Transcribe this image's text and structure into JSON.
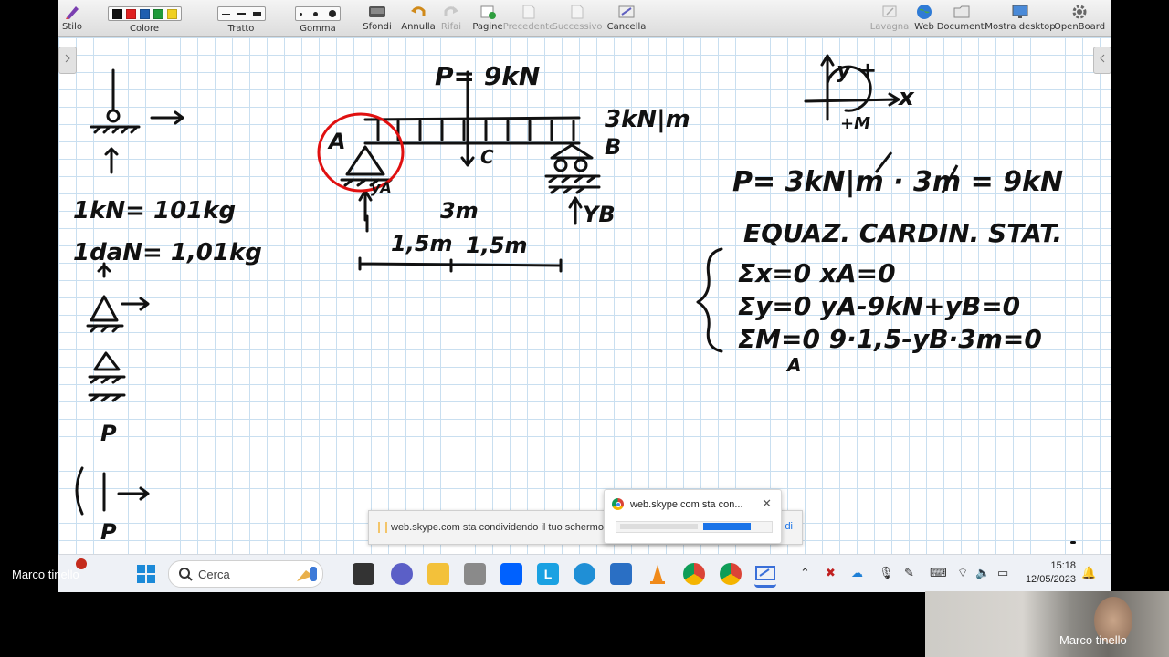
{
  "toolbar": {
    "stilo": "Stilo",
    "colore": "Colore",
    "tratto": "Tratto",
    "gomma": "Gomma",
    "sfondi": "Sfondi",
    "annulla": "Annulla",
    "rifai": "Rifai",
    "pagine": "Pagine",
    "precedente": "Precedente",
    "successivo": "Successivo",
    "cancella": "Cancella",
    "lavagna": "Lavagna",
    "web": "Web",
    "documenti": "Documenti",
    "mostra_desktop": "Mostra desktop",
    "openboard": "OpenBoard",
    "colors": [
      "#111111",
      "#e02020",
      "#1f5fb0",
      "#1f9a3a",
      "#f0d020"
    ]
  },
  "board": {
    "load": "P= 9kN",
    "distributed": "3kN|m",
    "label_a": "A",
    "label_b": "B",
    "label_c": "C",
    "ya": "yA",
    "yb": "YB",
    "span": "3m",
    "half1": "1,5m",
    "half2": "1,5m",
    "conv1": "1kN= 101kg",
    "conv2": "1daN= 1,01kg",
    "axis_y": "y +",
    "axis_x": "x",
    "moment": "+M",
    "eq_p": "P= 3kN|m · 3m = 9kN",
    "eq_title": "EQUAZ. CARDIN. STAT.",
    "eq1": "Σx=0   xA=0",
    "eq2": "Σy=0  yA-9kN+yB=0",
    "eq3": "ΣM=0  9·1,5-yB·3m=0",
    "eq3_sub": "A",
    "left_p": "P"
  },
  "share": {
    "bar_text": "web.skype.com sta condividendo il tuo schermo.",
    "toast_title": "web.skype.com sta con...",
    "link": "di"
  },
  "taskbar": {
    "search": "Cerca",
    "time": "15:18",
    "date": "12/05/2023"
  },
  "call": {
    "remote_name": "Marco tinello",
    "self_name": "Marco tinello"
  }
}
